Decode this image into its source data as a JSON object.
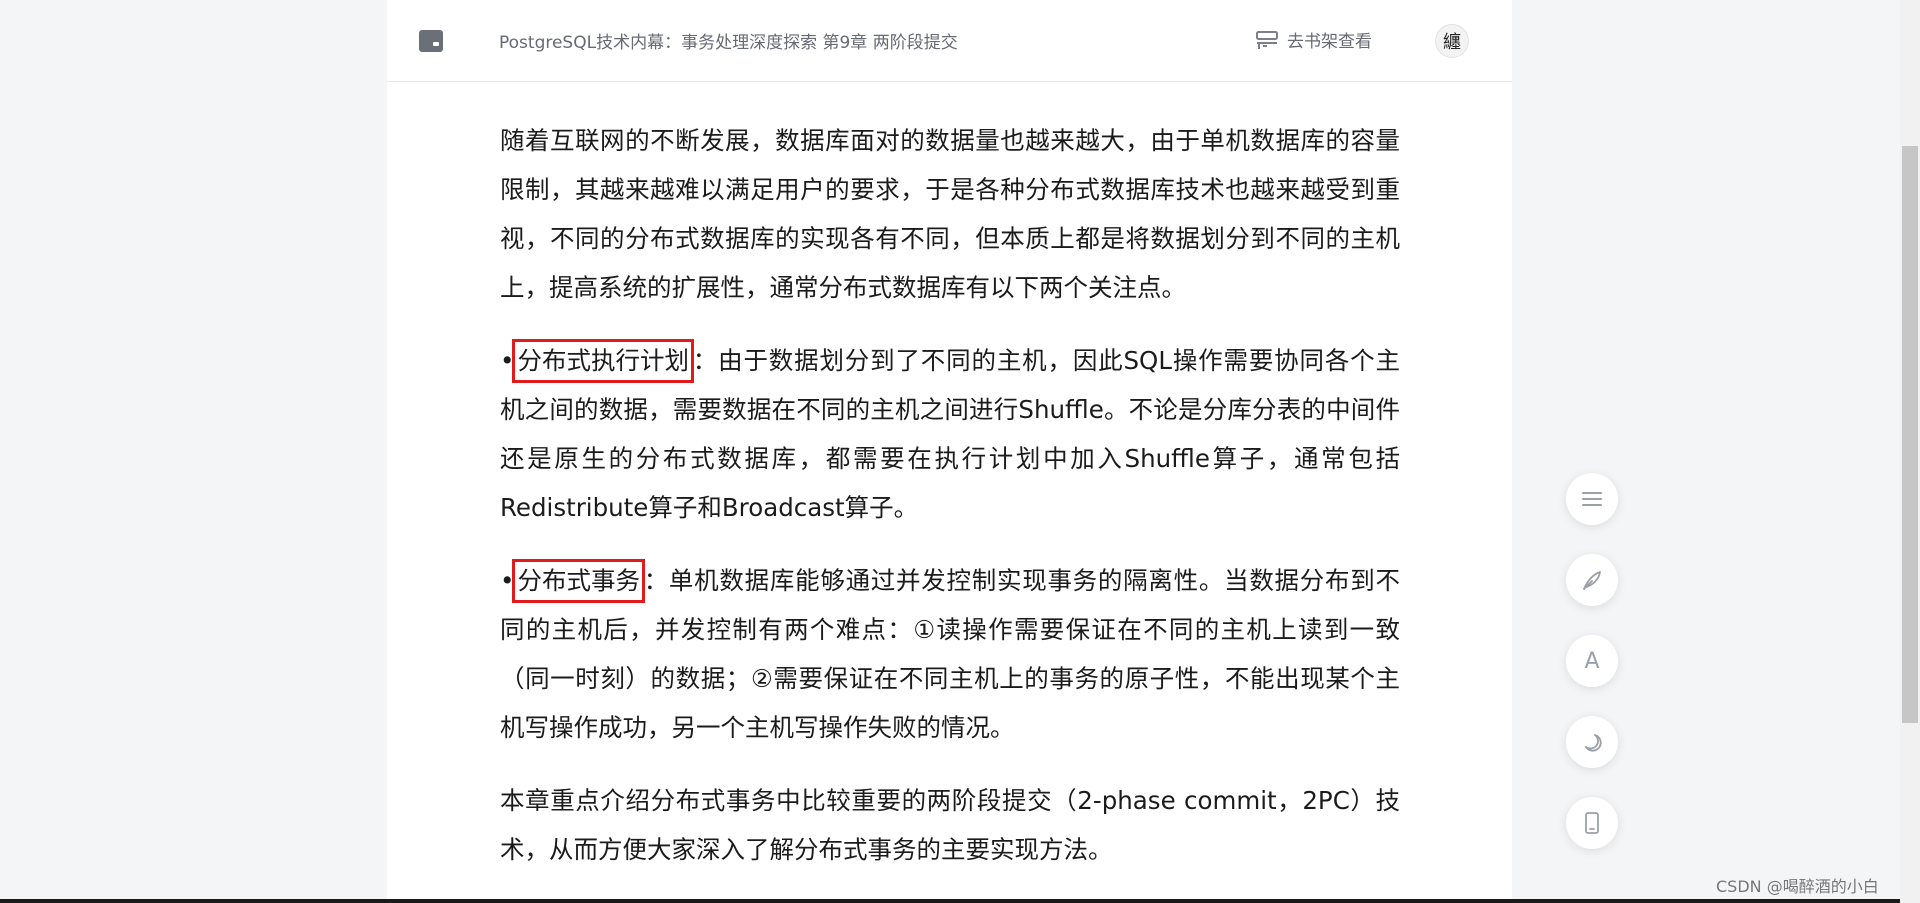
{
  "header": {
    "book_title": "PostgreSQL技术内幕：事务处理深度探索 第9章 两阶段提交",
    "shelf_label": "去书架查看",
    "avatar_glyph": "纏"
  },
  "article": {
    "para1": "随着互联网的不断发展，数据库面对的数据量也越来越大，由于单机数据库的容量限制，其越来越难以满足用户的要求，于是各种分布式数据库技术也越来越受到重视，不同的分布式数据库的实现各有不同，但本质上都是将数据划分到不同的主机上，提高系统的扩展性，通常分布式数据库有以下两个关注点。",
    "bullet1": {
      "marker": "•",
      "term": "分布式执行计划",
      "text": "：由于数据划分到了不同的主机，因此SQL操作需要协同各个主机之间的数据，需要数据在不同的主机之间进行Shuffle。不论是分库分表的中间件还是原生的分布式数据库，都需要在执行计划中加入Shuffle算子，通常包括Redistribute算子和Broadcast算子。"
    },
    "bullet2": {
      "marker": "•",
      "term": "分布式事务",
      "text": "：单机数据库能够通过并发控制实现事务的隔离性。当数据分布到不同的主机后，并发控制有两个难点：①读操作需要保证在不同的主机上读到一致（同一时刻）的数据；②需要保证在不同主机上的事务的原子性，不能出现某个主机写操作成功，另一个主机写操作失败的情况。"
    },
    "para_last": "本章重点介绍分布式事务中比较重要的两阶段提交（2-phase commit，2PC）技术，从而方便大家深入了解分布式事务的主要实现方法。"
  },
  "side_tools": {
    "catalog_icon": "menu-icon",
    "note_icon": "feather-icon",
    "font_label": "A",
    "night_icon": "moon-icon",
    "device_icon": "phone-icon"
  },
  "watermark": "CSDN @喝醉酒的小白",
  "colors": {
    "highlight_box": "#e11b1b",
    "page_bg": "#f4f5f7",
    "reader_bg": "#ffffff"
  }
}
